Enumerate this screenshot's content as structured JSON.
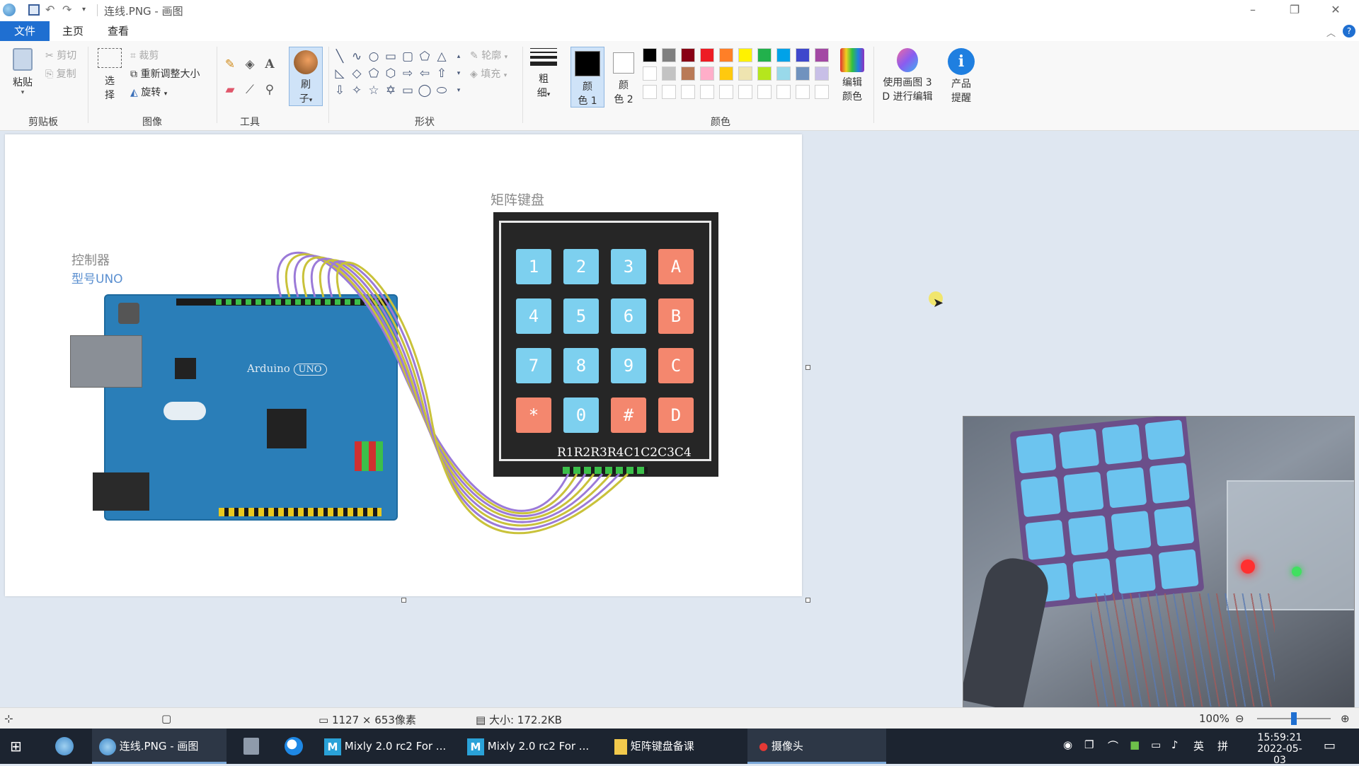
{
  "window": {
    "title": "连线.PNG - 画图"
  },
  "tabs": [
    {
      "label": "文件"
    },
    {
      "label": "主页"
    },
    {
      "label": "查看"
    }
  ],
  "ribbon": {
    "clipboard": {
      "paste": "粘贴",
      "cut": "剪切",
      "copy": "复制",
      "group": "剪贴板"
    },
    "image": {
      "select": "选",
      "select2": "择",
      "crop": "裁剪",
      "resize": "重新调整大小",
      "rotate": "旋转",
      "group": "图像"
    },
    "tools": {
      "group": "工具",
      "text_tool": "A"
    },
    "brush": {
      "label1": "刷",
      "label2": "子"
    },
    "shapes": {
      "outline": "轮廓",
      "fill": "填充",
      "group": "形状"
    },
    "size": {
      "label1": "粗",
      "label2": "细"
    },
    "color1": {
      "label1": "颜",
      "label2": "色 1"
    },
    "color2": {
      "label1": "颜",
      "label2": "色 2"
    },
    "colors": {
      "group": "颜色",
      "palette": [
        "#000000",
        "#7f7f7f",
        "#880015",
        "#ed1c24",
        "#ff7f27",
        "#fff200",
        "#22b14c",
        "#00a2e8",
        "#3f48cc",
        "#a349a4",
        "#ffffff",
        "#c3c3c3",
        "#b97a57",
        "#ffaec9",
        "#ffc90e",
        "#efe4b0",
        "#b5e61d",
        "#99d9ea",
        "#7092be",
        "#c8bfe7"
      ]
    },
    "edit_colors": {
      "label1": "编辑",
      "label2": "颜色"
    },
    "paint3d": {
      "label1": "使用画图 3",
      "label2": "D 进行编辑"
    },
    "product_alert": {
      "label1": "产品",
      "label2": "提醒"
    }
  },
  "canvas": {
    "controller_title": "控制器",
    "controller_model": "型号UNO",
    "board_text": "Arduino",
    "board_badge": "UNO",
    "keypad_title": "矩阵键盘",
    "keypad_pins": "R1R2R3R4C1C2C3C4",
    "keys": [
      {
        "label": "1",
        "kind": "num"
      },
      {
        "label": "2",
        "kind": "num"
      },
      {
        "label": "3",
        "kind": "num"
      },
      {
        "label": "A",
        "kind": "fn"
      },
      {
        "label": "4",
        "kind": "num"
      },
      {
        "label": "5",
        "kind": "num"
      },
      {
        "label": "6",
        "kind": "num"
      },
      {
        "label": "B",
        "kind": "fn"
      },
      {
        "label": "7",
        "kind": "num"
      },
      {
        "label": "8",
        "kind": "num"
      },
      {
        "label": "9",
        "kind": "num"
      },
      {
        "label": "C",
        "kind": "fn"
      },
      {
        "label": "*",
        "kind": "fn"
      },
      {
        "label": "0",
        "kind": "num"
      },
      {
        "label": "#",
        "kind": "fn"
      },
      {
        "label": "D",
        "kind": "fn"
      }
    ],
    "key_colors": {
      "num": "#7dd0ef",
      "fn": "#f4876e"
    },
    "wire_colors": [
      "#9b7ad8",
      "#c9c23a",
      "#9b7ad8",
      "#c9c23a",
      "#9b7ad8",
      "#c9c23a",
      "#9b7ad8",
      "#c9c23a"
    ]
  },
  "status": {
    "dimensions": "1127 × 653像素",
    "size": "大小: 172.2KB",
    "zoom": "100%",
    "zoom_level": 1.0
  },
  "taskbar": {
    "items": [
      {
        "label": "连线.PNG - 画图"
      },
      {
        "label": "Mixly 2.0 rc2 For ..."
      },
      {
        "label": "Mixly 2.0 rc2 For ..."
      },
      {
        "label": "矩阵键盘备课"
      },
      {
        "label": "摄像头"
      }
    ],
    "ime": "英",
    "ime2": "拼",
    "time": "15:59:21",
    "date": "2022-05-03"
  }
}
